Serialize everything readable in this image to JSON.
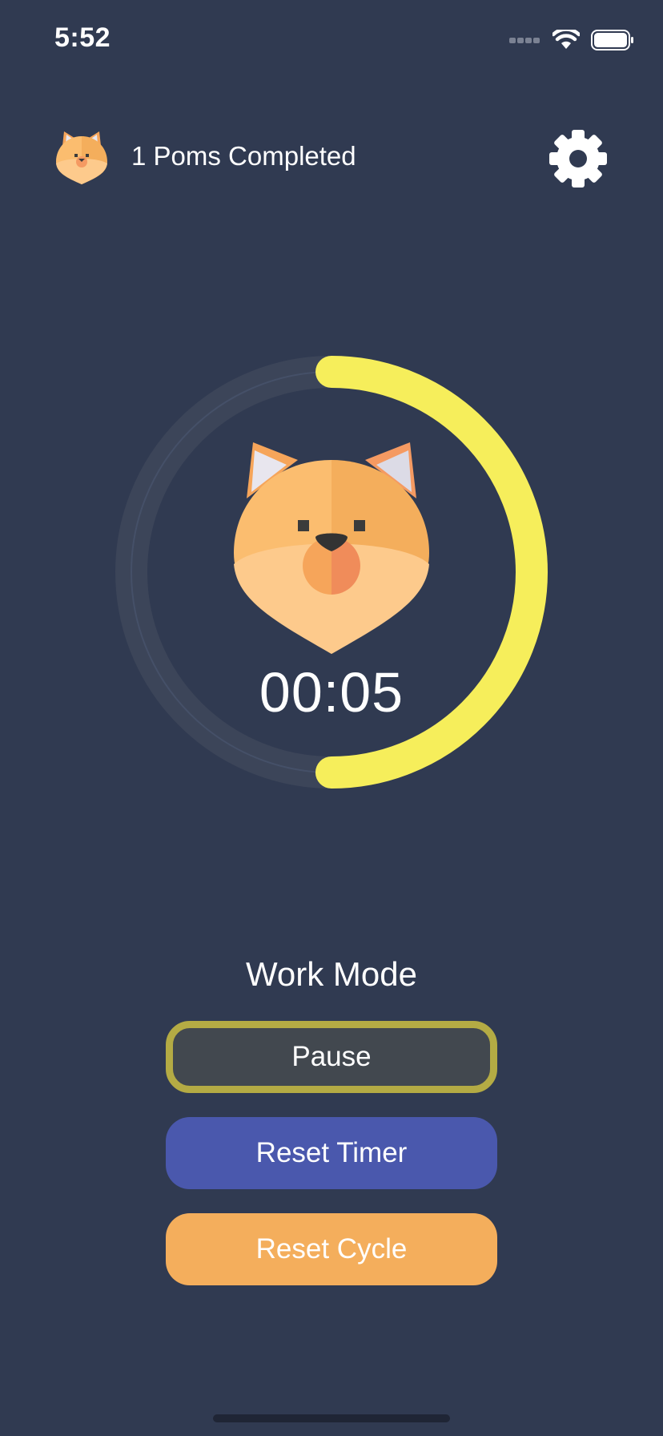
{
  "status_bar": {
    "time": "5:52",
    "icons": [
      "cellular-signal-icon",
      "wifi-icon",
      "battery-icon"
    ]
  },
  "header": {
    "avatar_icon": "pom-dog-icon",
    "poms_completed": "1 Poms Completed",
    "settings_icon": "gear-icon"
  },
  "timer": {
    "time_remaining": "00:05",
    "progress_fraction": 0.5,
    "mascot_icon": "pom-dog-face-icon"
  },
  "mode": {
    "label": "Work Mode"
  },
  "buttons": {
    "pause": "Pause",
    "reset_timer": "Reset Timer",
    "reset_cycle": "Reset Cycle"
  },
  "colors": {
    "background": "#303a51",
    "progress": "#f6ee5b",
    "track": "#3c4559",
    "pause_border": "#b4ab44",
    "pause_fill": "#42484f",
    "reset_timer": "#4a58ad",
    "reset_cycle": "#f4ae5c"
  }
}
